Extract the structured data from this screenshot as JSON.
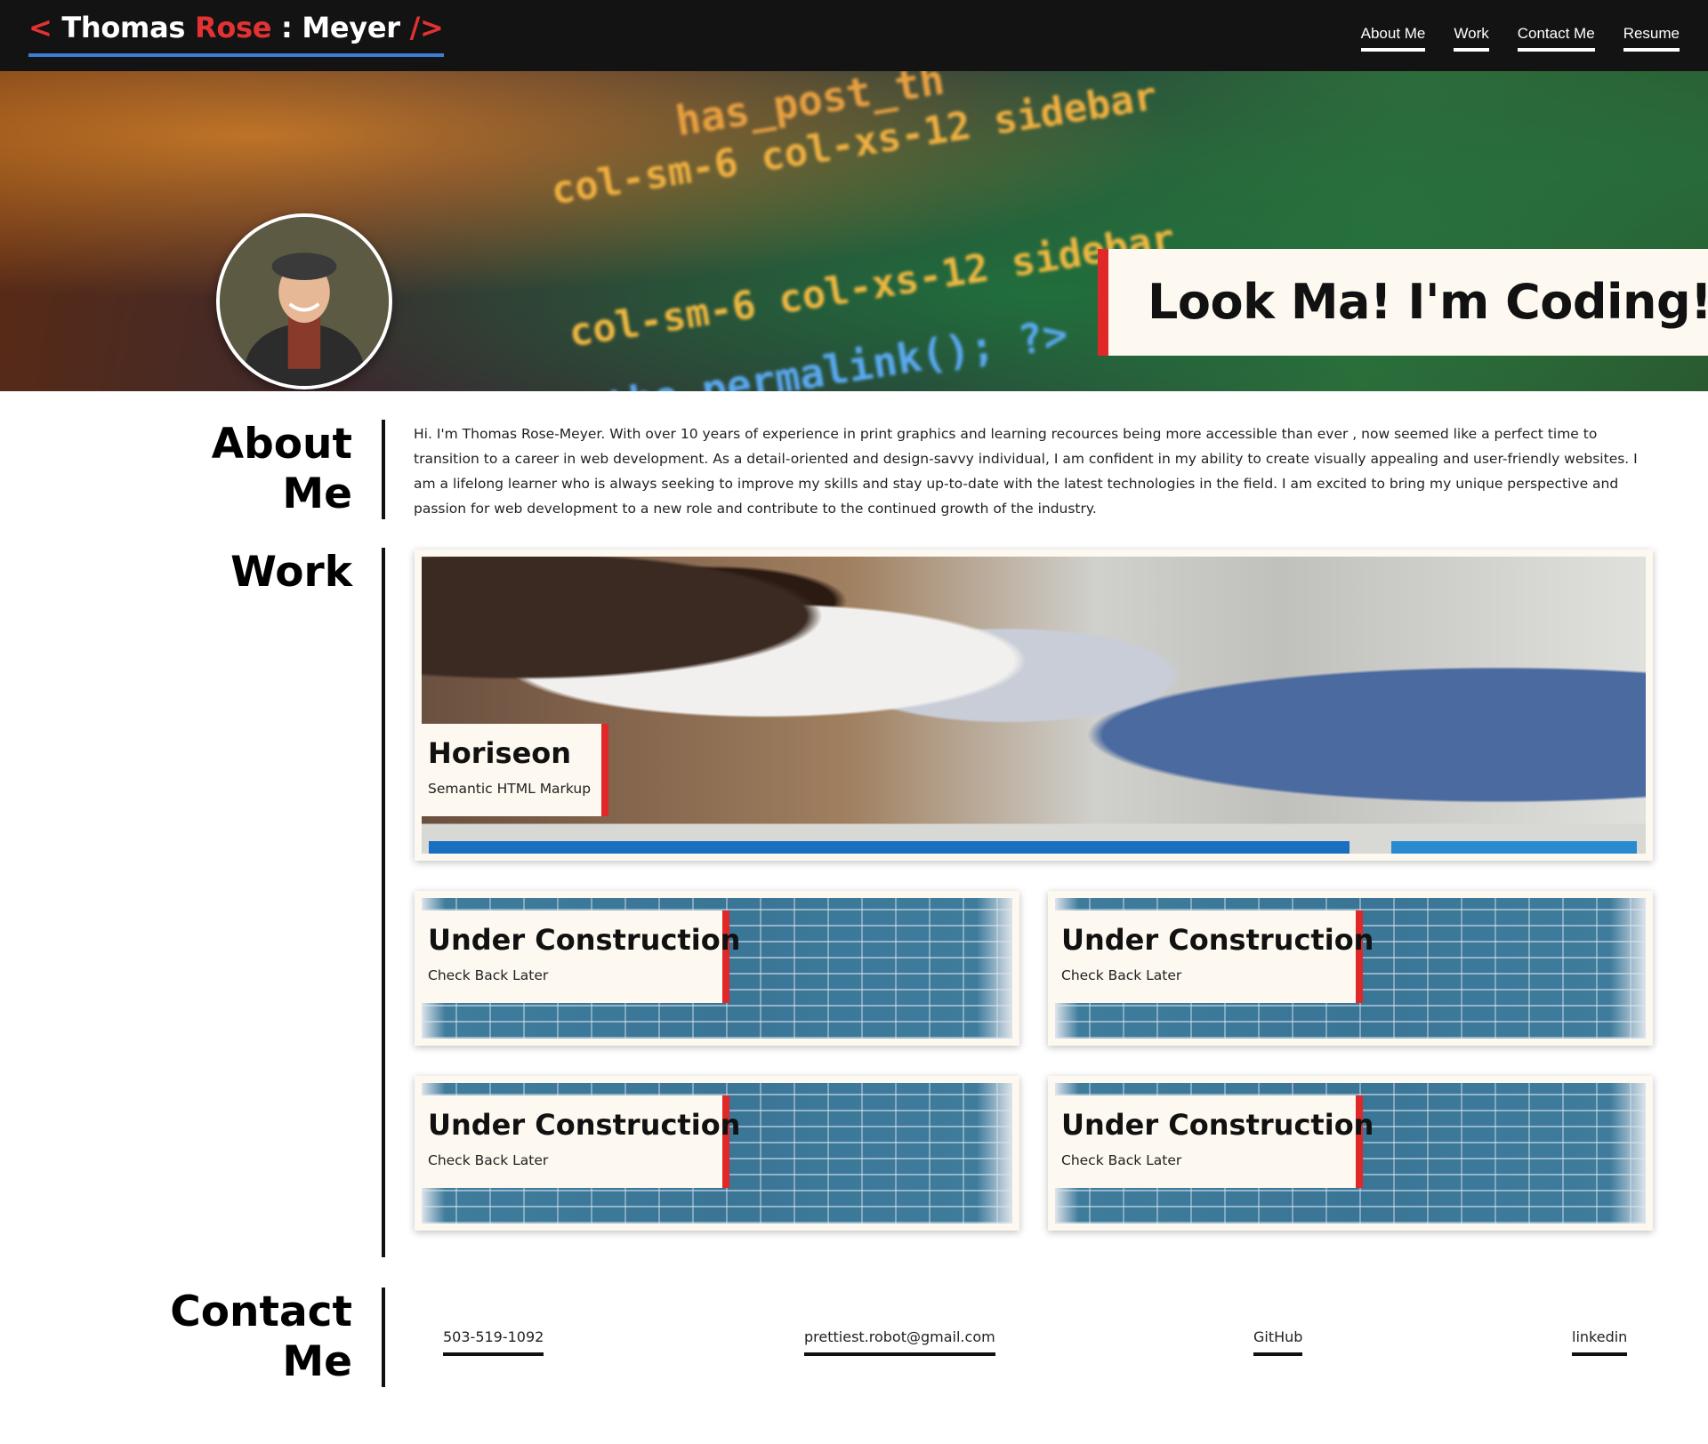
{
  "header": {
    "logo": {
      "open_bracket": "<",
      "first_name": "Thomas",
      "rose": "Rose",
      "separator": ":",
      "last_name": "Meyer",
      "close_bracket": "/>"
    },
    "nav": [
      {
        "label": "About Me"
      },
      {
        "label": "Work"
      },
      {
        "label": "Contact Me"
      },
      {
        "label": "Resume"
      }
    ]
  },
  "hero": {
    "title": "Look Ma! I'm Coding!",
    "background_code": [
      "has_post_th",
      "col-sm-6 col-xs-12 sidebar",
      "col-sm-6 col-xs-12 sidebar",
      "the_permalink(); ?>"
    ]
  },
  "about": {
    "heading_line1": "About",
    "heading_line2": "Me",
    "text": "Hi. I'm Thomas Rose-Meyer. With over 10 years of experience in print graphics and learning recources being more accessible than ever , now seemed like a perfect time to transition to a career in web development. As a detail-oriented and design-savvy individual, I am confident in my ability to create visually appealing and user-friendly websites. I am a lifelong learner who is always seeking to improve my skills and stay up-to-date with the latest technologies in the field. I am excited to bring my unique perspective and passion for web development to a new role and contribute to the continued growth of the industry."
  },
  "work": {
    "heading": "Work",
    "featured": {
      "title": "Horiseon",
      "subtitle": "Semantic HTML Markup"
    },
    "projects": [
      {
        "title": "Under Construction",
        "subtitle": "Check Back Later"
      },
      {
        "title": "Under Construction",
        "subtitle": "Check Back Later"
      },
      {
        "title": "Under Construction",
        "subtitle": "Check Back Later"
      },
      {
        "title": "Under Construction",
        "subtitle": "Check Back Later"
      }
    ]
  },
  "contact": {
    "heading_line1": "Contact",
    "heading_line2": "Me",
    "links": [
      {
        "label": "503-519-1092"
      },
      {
        "label": "prettiest.robot@gmail.com"
      },
      {
        "label": "GitHub"
      },
      {
        "label": "linkedin"
      }
    ]
  },
  "colors": {
    "accent_red": "#e02828",
    "accent_blue": "#3a7fd4",
    "header_bg": "#131313",
    "card_bg": "#fdf8f0"
  }
}
